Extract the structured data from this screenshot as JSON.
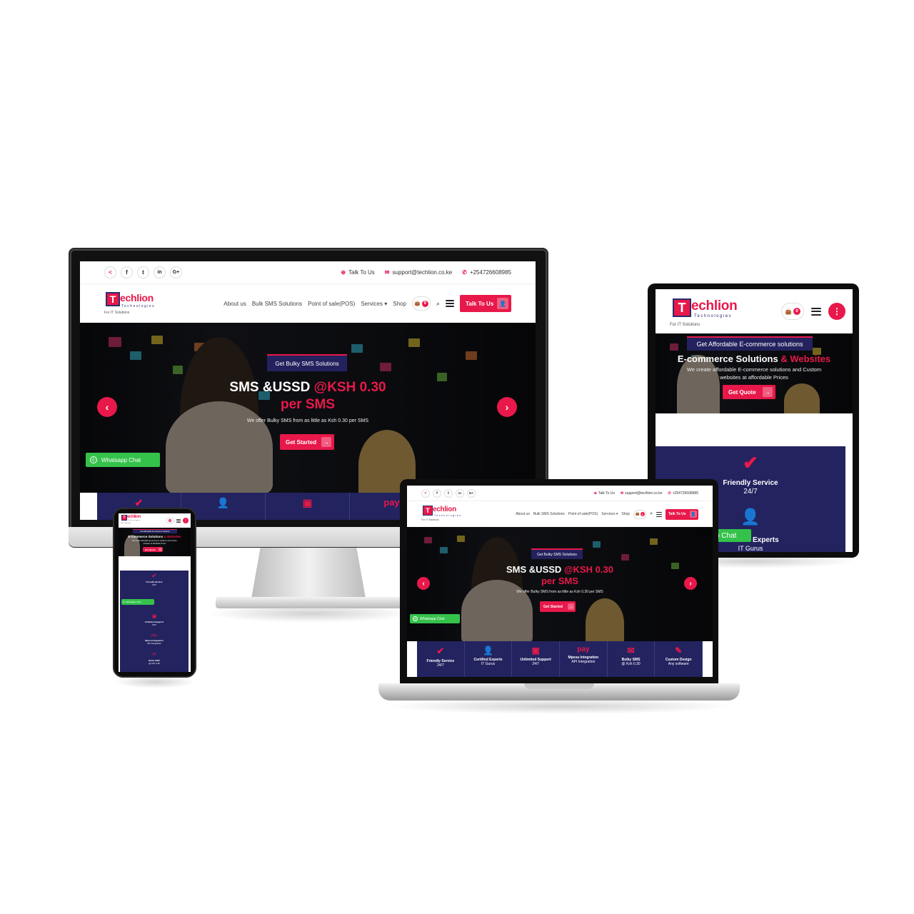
{
  "brand": {
    "logo_letter": "T",
    "logo_word": "echlion",
    "logo_sub": "Technologies",
    "tagline": "For IT Solutions",
    "accent": "#e8184a",
    "navy": "#232360",
    "whatsapp_green": "#35c24b"
  },
  "topbar": {
    "social_icons": [
      "share-icon",
      "facebook-icon",
      "twitter-icon",
      "linkedin-icon",
      "google-plus-icon"
    ],
    "social_glyphs": [
      "<",
      "f",
      "t",
      "in",
      "G+"
    ],
    "talk_label": "Talk To Us",
    "email": "support@techlion.co.ke",
    "phone": "+254726608985"
  },
  "nav": {
    "about": "About us",
    "bulk_sms": "Bulk SMS Solutions",
    "pos": "Point of sale(POS)",
    "services": "Services",
    "shop": "Shop",
    "cart_count": "0",
    "cta": "Talk To Us"
  },
  "hero": {
    "pill": "Get Bulky SMS Solutions",
    "title_white": "SMS &USSD ",
    "title_red": "@KSH 0.30",
    "title_line2": "per SMS",
    "subtitle": "We offer Bulky SMS from as little as Ksh 0.30 per SMS",
    "button": "Get Started",
    "prev": "‹",
    "next": "›"
  },
  "whatsapp": {
    "label": "Whatsapp Chat"
  },
  "tablet_hero": {
    "pill": "Get Affordable E-commerce solutions",
    "title_white": "E-commerce Solutions ",
    "title_red": "& Websites",
    "subtitle_line1": "We create affordable E-commerce solutions and Custom",
    "subtitle_line2": "websites at affordable Prices",
    "button": "Get Quote"
  },
  "features": [
    {
      "icon": "checkmark-icon",
      "glyph": "✔",
      "title": "Friendly Service",
      "sub": "24/7"
    },
    {
      "icon": "expert-icon",
      "glyph": "👤",
      "title": "Certified Experts",
      "sub": "IT Gurus"
    },
    {
      "icon": "mouse-icon",
      "glyph": "▣",
      "title": "Unlimited Support",
      "sub": "24/7"
    },
    {
      "icon": "mpesa-pay-icon",
      "glyph": "pay",
      "title": "Mpesa Integration",
      "sub": "API Integration"
    },
    {
      "icon": "sms-icon",
      "glyph": "✉",
      "title": "Bulky SMS",
      "sub": "@ Ksh 0.30"
    },
    {
      "icon": "design-icon",
      "glyph": "✎",
      "title": "Custom Design",
      "sub": "Any software"
    }
  ],
  "tablet_partial": {
    "whatsapp_fragment": "p Chat",
    "experts_fragment": "Experts",
    "gurus": "IT Gurus"
  }
}
